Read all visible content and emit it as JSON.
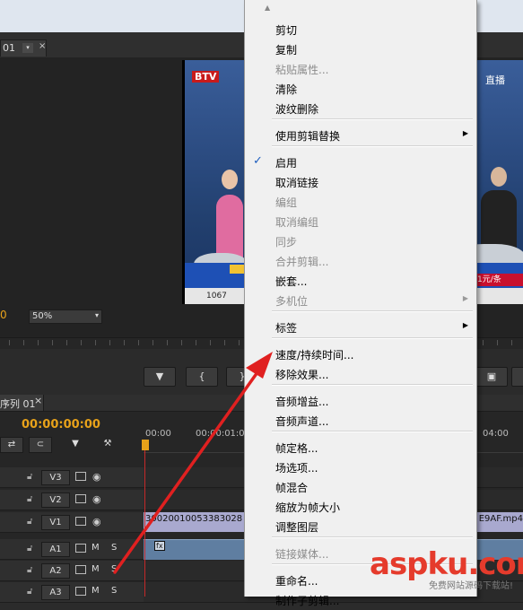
{
  "monitor": {
    "tab_label": "01",
    "tab_close": "×",
    "dropdown_arrow": "▾",
    "timecode_left": "0",
    "zoom_value": "50%",
    "zoom_arrow": "▾",
    "buttons": [
      "▼",
      "{",
      "}"
    ]
  },
  "video": {
    "channel_logo": "BTV",
    "live_label": "直播",
    "ticker_text": "1067",
    "ticker_price": "…1元/条"
  },
  "timeline": {
    "tab_label": "序列 01",
    "tab_close": "×",
    "timecode": "00:00:00:00",
    "ruler_labels": [
      "00:00",
      "00:00:01:00",
      "04:00"
    ],
    "tools": {
      "snap": "⊂",
      "marker": "▼",
      "wrench": "⚒",
      "insert": "⇄"
    },
    "tracks": [
      {
        "name": "V3",
        "type": "video"
      },
      {
        "name": "V2",
        "type": "video"
      },
      {
        "name": "V1",
        "type": "video"
      },
      {
        "name": "A1",
        "type": "audio",
        "m": "M",
        "s": "S"
      },
      {
        "name": "A2",
        "type": "audio",
        "m": "M",
        "s": "S"
      },
      {
        "name": "A3",
        "type": "audio",
        "m": "M",
        "s": "S"
      }
    ],
    "video_clip": {
      "name_start": "30020010053383028",
      "name_end": "E9AF.mp4"
    },
    "audio_clip": {
      "fx": "fx"
    }
  },
  "context_menu": {
    "scroll_up": "▲",
    "items": [
      {
        "label": "剪切",
        "enabled": true
      },
      {
        "label": "复制",
        "enabled": true
      },
      {
        "label": "粘贴属性...",
        "enabled": false
      },
      {
        "label": "清除",
        "enabled": true
      },
      {
        "label": "波纹删除",
        "enabled": true
      },
      {
        "label": "使用剪辑替换",
        "enabled": true,
        "submenu": true
      },
      {
        "label": "启用",
        "enabled": true,
        "checked": true
      },
      {
        "label": "取消链接",
        "enabled": true
      },
      {
        "label": "编组",
        "enabled": false
      },
      {
        "label": "取消编组",
        "enabled": false
      },
      {
        "label": "同步",
        "enabled": false
      },
      {
        "label": "合并剪辑...",
        "enabled": false
      },
      {
        "label": "嵌套...",
        "enabled": true
      },
      {
        "label": "多机位",
        "enabled": false,
        "submenu": true
      },
      {
        "label": "标签",
        "enabled": true,
        "submenu": true
      },
      {
        "label": "速度/持续时间...",
        "enabled": true
      },
      {
        "label": "移除效果...",
        "enabled": true
      },
      {
        "label": "音频增益...",
        "enabled": true
      },
      {
        "label": "音频声道...",
        "enabled": true
      },
      {
        "label": "帧定格...",
        "enabled": true
      },
      {
        "label": "场选项...",
        "enabled": true
      },
      {
        "label": "帧混合",
        "enabled": true
      },
      {
        "label": "缩放为帧大小",
        "enabled": true
      },
      {
        "label": "调整图层",
        "enabled": true
      },
      {
        "label": "链接媒体...",
        "enabled": false
      },
      {
        "label": "重命名...",
        "enabled": true
      },
      {
        "label": "制作子剪辑...",
        "enabled": true
      }
    ],
    "check_mark": "✓",
    "submenu_arrow": "▶"
  },
  "watermark": {
    "text": "aspku.com",
    "subtext": "免费网站源码下载站!"
  },
  "colors": {
    "accent_timecode": "#e8a21a",
    "arrow": "#e02020",
    "watermark": "#e53b2c"
  }
}
